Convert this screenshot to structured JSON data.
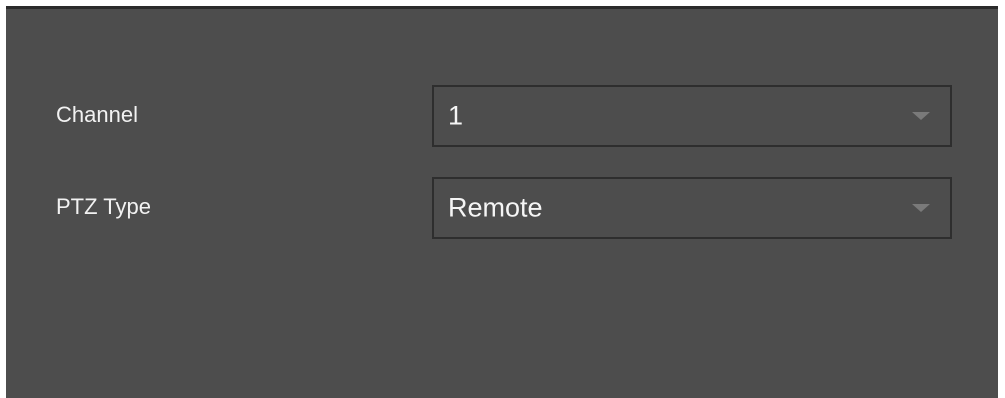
{
  "form": {
    "channel": {
      "label": "Channel",
      "value": "1"
    },
    "ptz_type": {
      "label": "PTZ Type",
      "value": "Remote"
    }
  },
  "icons": {
    "dropdown_arrow": "chevron-down-icon"
  },
  "colors": {
    "panel_background": "#4d4d4d",
    "text": "#f2f2f2",
    "select_border": "#2e2e2e",
    "arrow": "#7a7a7a"
  }
}
